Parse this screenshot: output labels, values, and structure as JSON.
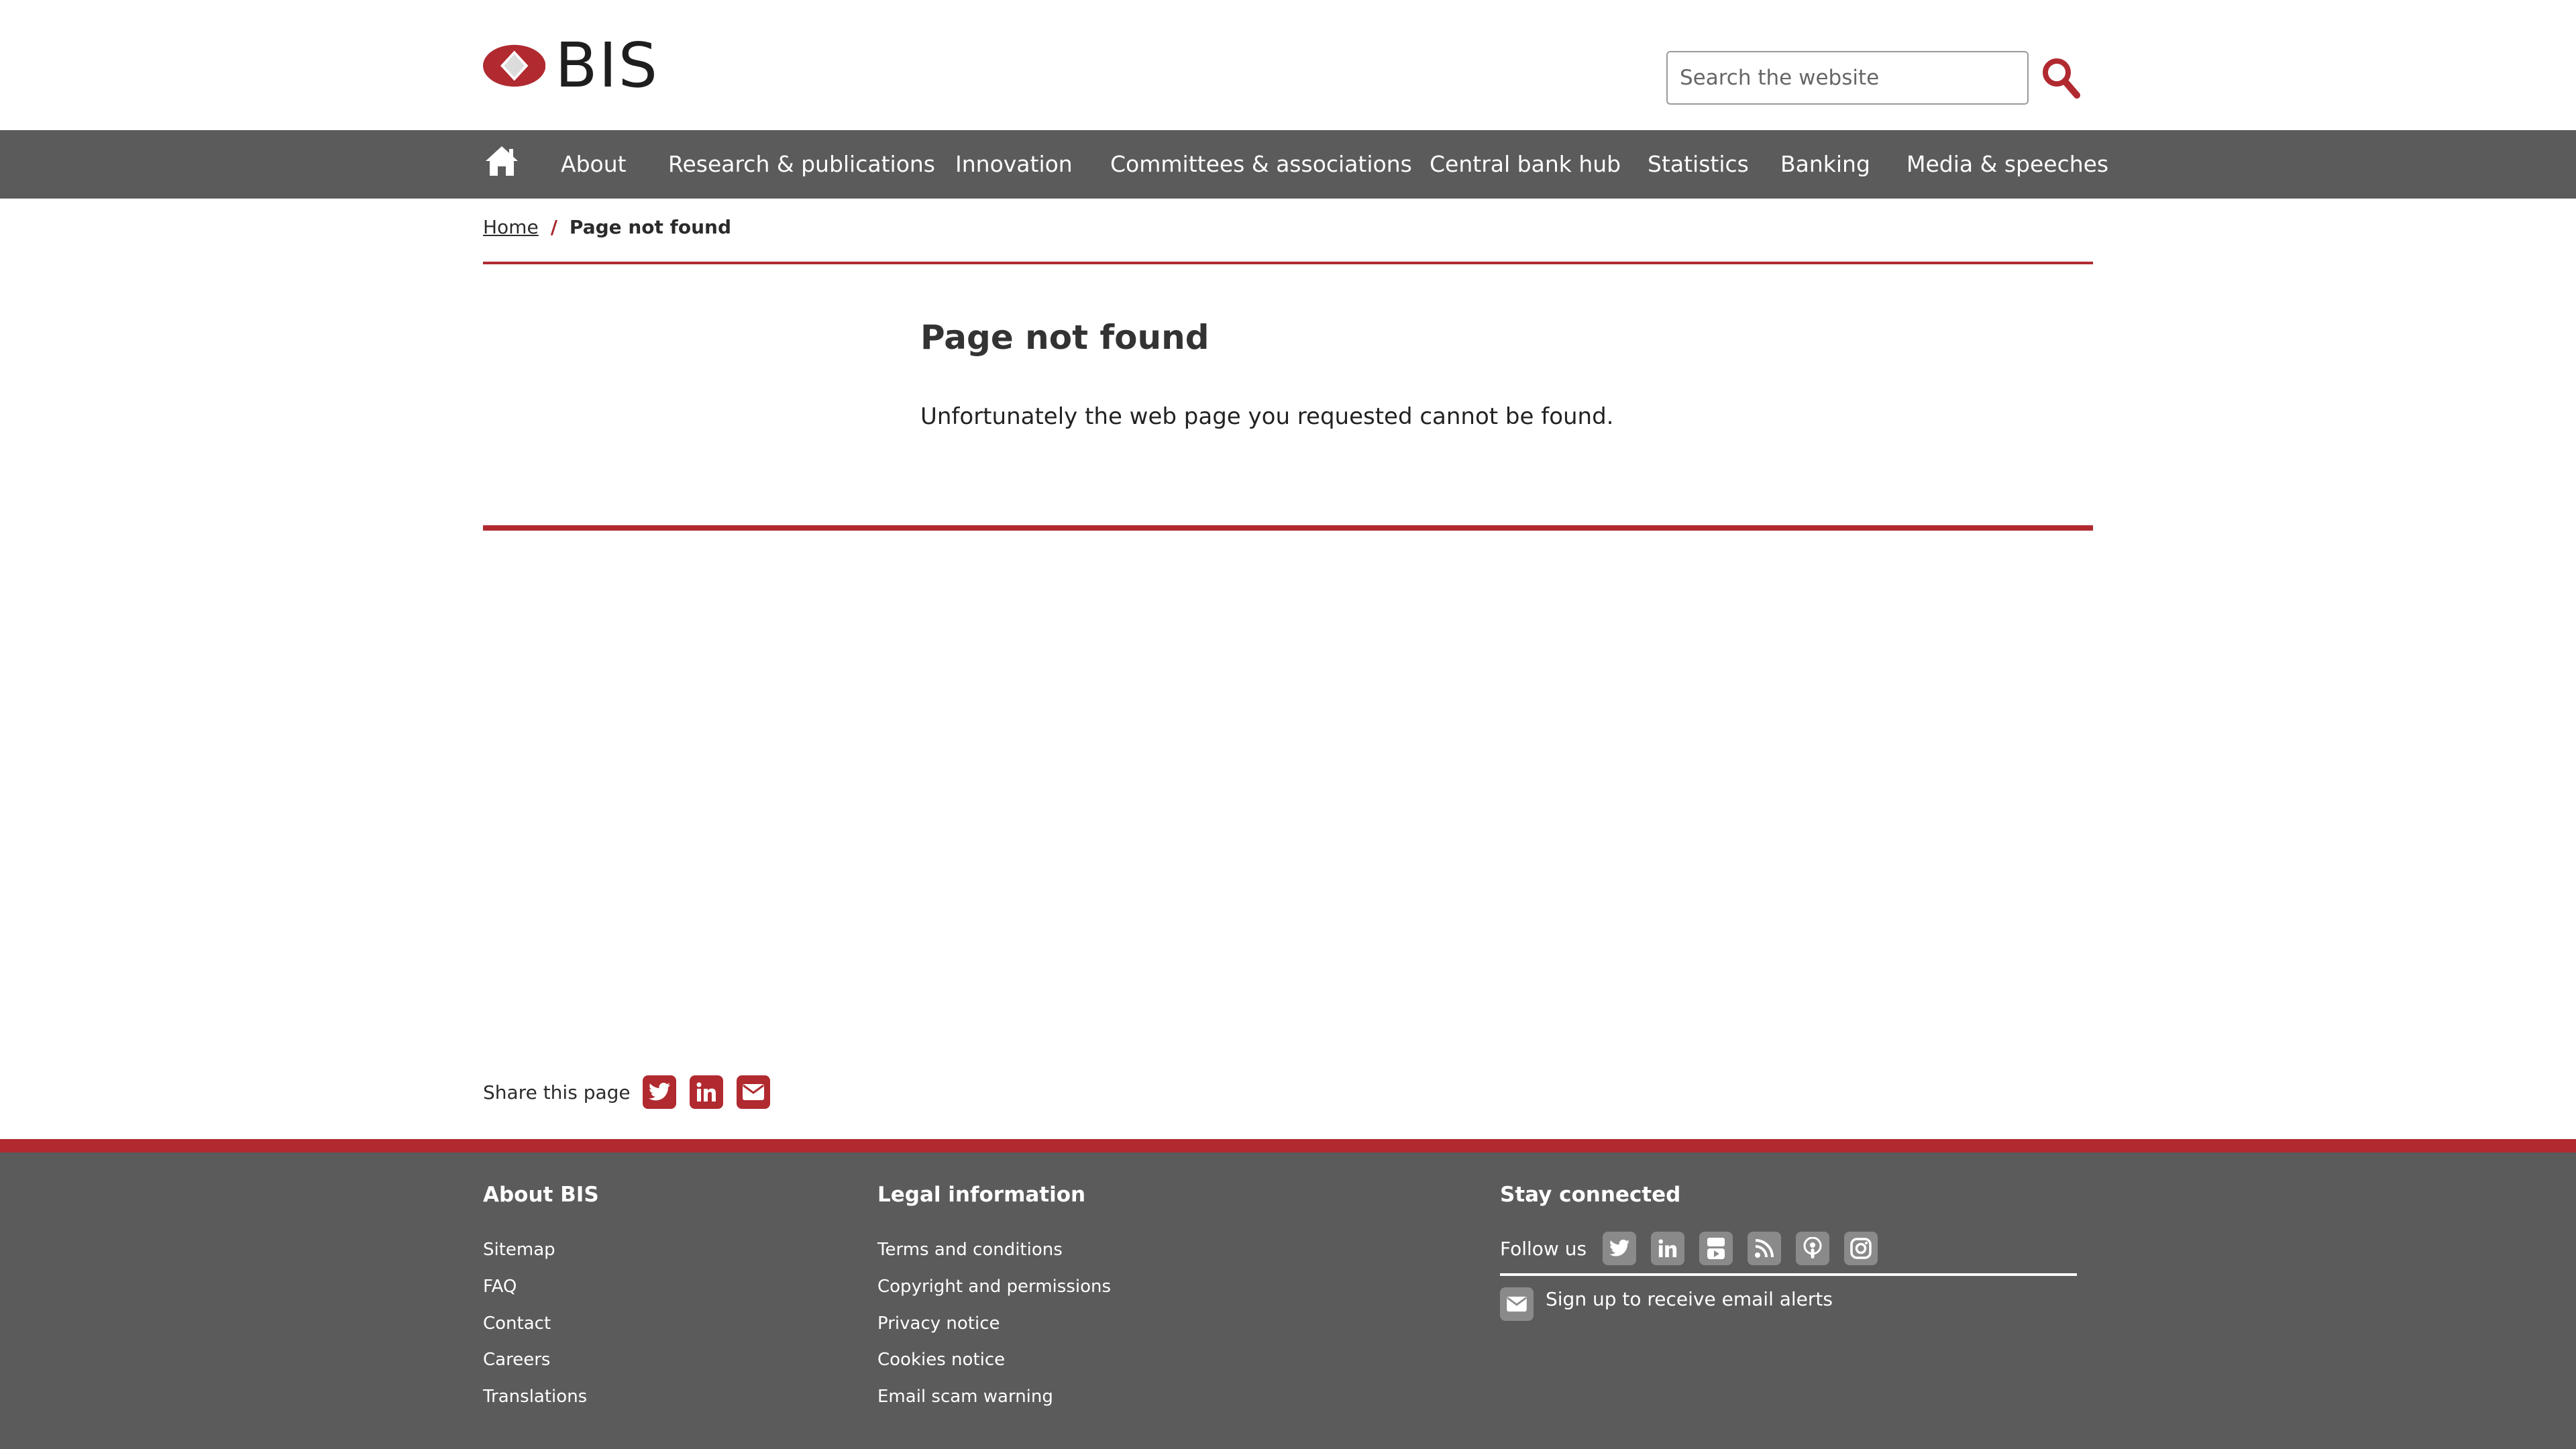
{
  "header": {
    "logo_text": "BIS",
    "search": {
      "placeholder": "Search the website",
      "value": ""
    }
  },
  "nav": {
    "home_icon": "home-icon",
    "items": [
      "About",
      "Research & publications",
      "Innovation",
      "Committees & associations",
      "Central bank hub",
      "Statistics",
      "Banking",
      "Media & speeches"
    ]
  },
  "breadcrumb": {
    "home": "Home",
    "separator": "/",
    "current": "Page not found"
  },
  "main": {
    "title": "Page not found",
    "message": "Unfortunately the web page you requested cannot be found."
  },
  "share": {
    "label": "Share this page",
    "icons": [
      "twitter-icon",
      "linkedin-icon",
      "email-icon"
    ]
  },
  "footer": {
    "about": {
      "title": "About BIS",
      "links": [
        "Sitemap",
        "FAQ",
        "Contact",
        "Careers",
        "Translations"
      ]
    },
    "legal": {
      "title": "Legal information",
      "links": [
        "Terms and conditions",
        "Copyright and permissions",
        "Privacy notice",
        "Cookies notice",
        "Email scam warning"
      ]
    },
    "connect": {
      "title": "Stay connected",
      "follow_label": "Follow us",
      "icons": [
        "twitter-icon",
        "linkedin-icon",
        "youtube-icon",
        "rss-icon",
        "podcast-icon",
        "instagram-icon"
      ],
      "signup_label": "Sign up to receive email alerts"
    }
  },
  "colors": {
    "brand_red": "#b02a30",
    "nav_gray": "#5b5b5b",
    "footer_icon_gray": "#8a8a8a"
  }
}
